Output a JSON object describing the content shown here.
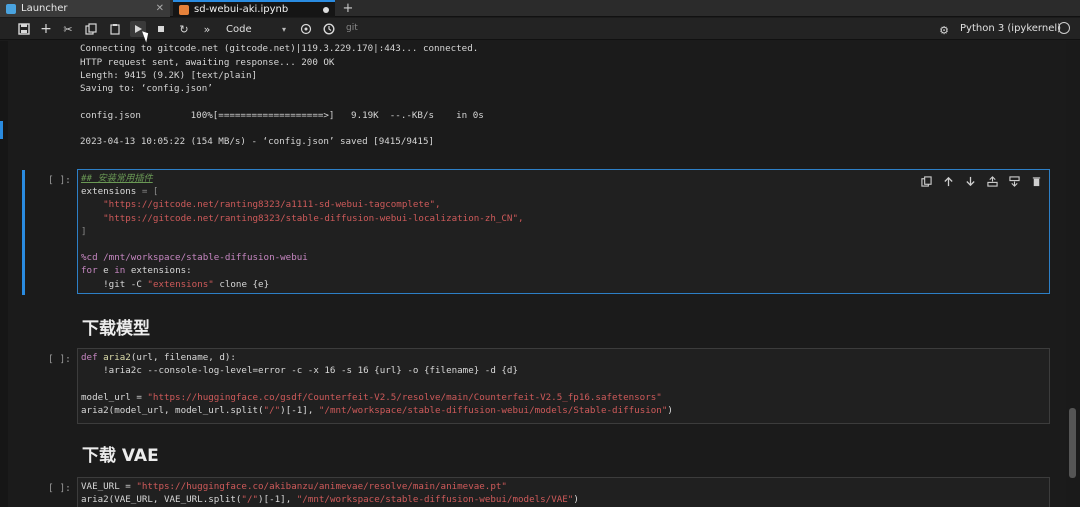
{
  "tabs": [
    {
      "label": "Launcher"
    },
    {
      "label": "sd-webui-aki.ipynb"
    }
  ],
  "toolbar": {
    "cell_type": "Code",
    "git_label": "git",
    "kernel_name": "Python 3 (ipykernel)"
  },
  "output_lines": [
    "Connecting to gitcode.net (gitcode.net)|119.3.229.170|:443... connected.",
    "HTTP request sent, awaiting response... 200 OK",
    "Length: 9415 (9.2K) [text/plain]",
    "Saving to: ‘config.json’",
    "",
    "config.json         100%[===================>]   9.19K  --.-KB/s    in 0s",
    "",
    "2023-04-13 10:05:22 (154 MB/s) - ‘config.json’ saved [9415/9415]"
  ],
  "cells": [
    {
      "prompt": "[ ]:"
    },
    {
      "prompt": "[ ]:"
    },
    {
      "prompt": "[ ]:"
    }
  ],
  "cell1": {
    "comment": "## 安装常用插件",
    "l2a": "extensions",
    "l2b": " = [",
    "l3": "\"https://gitcode.net/ranting8323/a1111-sd-webui-tagcomplete\",",
    "l4": "\"https://gitcode.net/ranting8323/stable-diffusion-webui-localization-zh_CN\",",
    "l5": "]",
    "l7": "%cd /mnt/workspace/stable-diffusion-webui",
    "l8a": "for",
    "l8b": " e ",
    "l8c": "in",
    "l8d": " extensions:",
    "l9a": "!git -C ",
    "l9b": "\"extensions\"",
    "l9c": " clone {e}"
  },
  "md1": "下载模型",
  "cell2": {
    "l1a": "def",
    "l1b": " aria2",
    "l1c": "(url, filename, d):",
    "l2": "!aria2c --console-log-level=error -c -x 16 -s 16 {url} -o {filename} -d {d}",
    "l4a": "model_url = ",
    "l4b": "\"https://huggingface.co/gsdf/Counterfeit-V2.5/resolve/main/Counterfeit-V2.5_fp16.safetensors\"",
    "l5a": "aria2(model_url, model_url.split(",
    "l5b": "\"/\"",
    "l5c": ")[-1], ",
    "l5d": "\"/mnt/workspace/stable-diffusion-webui/models/Stable-diffusion\"",
    "l5e": ")"
  },
  "md2": "下载 VAE",
  "cell3": {
    "l1a": "VAE_URL = ",
    "l1b": "\"https://huggingface.co/akibanzu/animevae/resolve/main/animevae.pt\"",
    "l2a": "aria2(VAE_URL, VAE_URL.split(",
    "l2b": "\"/\"",
    "l2c": ")[-1], ",
    "l2d": "\"/mnt/workspace/stable-diffusion-webui/models/VAE\"",
    "l2e": ")"
  },
  "colors": {
    "accent": "#2a8be0",
    "string": "#ce5a5a",
    "keyword": "#c586c0",
    "comment": "#6a9955"
  }
}
